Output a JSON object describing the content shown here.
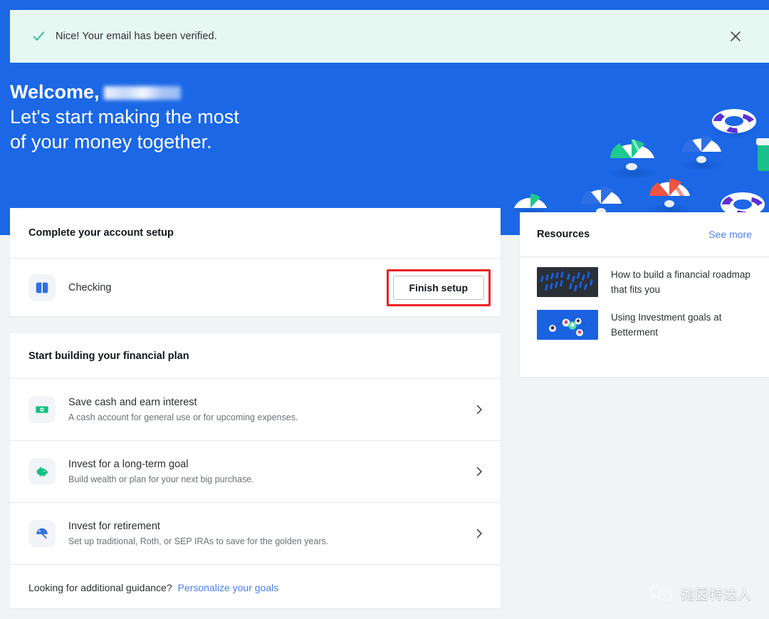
{
  "colors": {
    "hero_blue": "#1b67e6",
    "alert_bg": "#e7f7f2",
    "page_bg": "#f1f3f4",
    "link_blue": "#4a7ff0",
    "highlight_red": "#ec2024",
    "check_green": "#21c08b",
    "cash_green": "#11c182"
  },
  "alert": {
    "icon": "check-icon",
    "message": "Nice! Your email has been verified.",
    "close_icon": "close-icon"
  },
  "hero": {
    "greeting": "Welcome,",
    "name_redacted": "",
    "line2": "Let's start making the most",
    "line3": "of your money together.",
    "art": "beach-umbrellas-and-life-rings-illustration"
  },
  "setup_card": {
    "title": "Complete your account setup",
    "row": {
      "icon": "checking-account-icon",
      "label": "Checking",
      "button_label": "Finish setup",
      "highlighted": true
    }
  },
  "plan_card": {
    "title": "Start building your financial plan",
    "items": [
      {
        "icon": "cash-bill-icon",
        "title": "Save cash and earn interest",
        "desc": "A cash account for general use or for upcoming expenses.",
        "chevron": "chevron-right-icon"
      },
      {
        "icon": "piggy-bank-icon",
        "title": "Invest for a long-term goal",
        "desc": "Build wealth or plan for your next big purchase.",
        "chevron": "chevron-right-icon"
      },
      {
        "icon": "umbrella-icon",
        "title": "Invest for retirement",
        "desc": "Set up traditional, Roth, or SEP IRAs to save for the golden years.",
        "chevron": "chevron-right-icon"
      }
    ],
    "footer": {
      "text": "Looking for additional guidance?",
      "link": "Personalize your goals"
    }
  },
  "resources_card": {
    "title": "Resources",
    "see_more": "See more",
    "items": [
      {
        "thumb": "dark-blue-pins-thumbnail",
        "title": "How to build a financial roadmap that fits you"
      },
      {
        "thumb": "soccer-balls-on-blue-thumbnail",
        "title": "Using Investment goals at Betterment"
      }
    ]
  },
  "watermark": {
    "icon": "wechat-icon",
    "text": "抛因特达人"
  }
}
